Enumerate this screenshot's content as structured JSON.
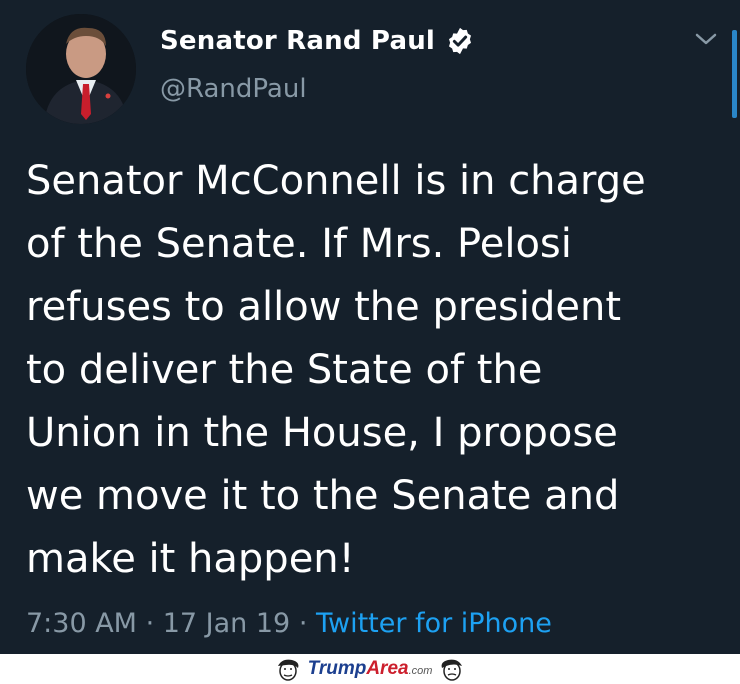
{
  "tweet": {
    "display_name": "Senator Rand Paul",
    "handle": "@RandPaul",
    "verified": true,
    "text_lines": [
      "Senator McConnell is in charge",
      "of the Senate. If Mrs. Pelosi",
      "refuses to allow the president",
      "to deliver the State of the",
      "Union in the House, I propose",
      "we move it to the Senate and",
      "make it happen!"
    ],
    "time": "7:30 AM",
    "separator": " · ",
    "date": "17 Jan 19",
    "source": "Twitter for iPhone"
  },
  "icons": {
    "verified": "verified-badge-icon",
    "menu": "chevron-down-icon"
  },
  "watermark": {
    "part1": "Trump",
    "part2": "Area",
    "part3": ".com"
  },
  "colors": {
    "background": "#15202b",
    "text": "#ffffff",
    "secondary_text": "#8899a6",
    "link": "#1da1f2"
  }
}
